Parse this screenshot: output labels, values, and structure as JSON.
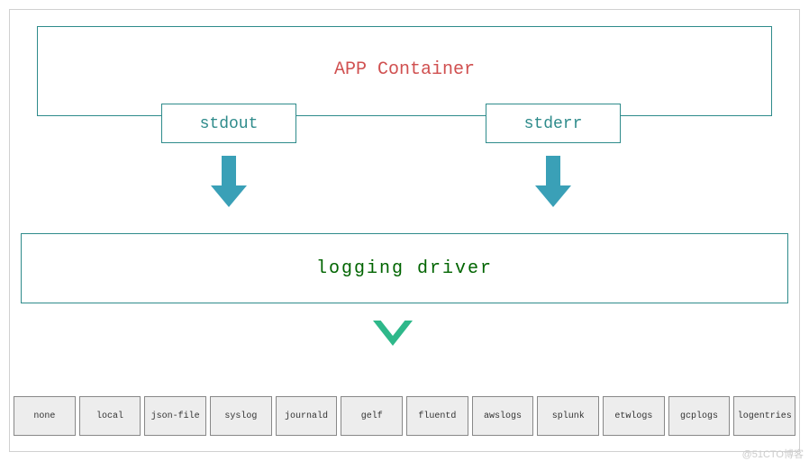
{
  "app_container": {
    "label": "APP Container"
  },
  "streams": {
    "stdout": "stdout",
    "stderr": "stderr"
  },
  "logging_driver": {
    "label": "logging  driver"
  },
  "drivers": [
    {
      "name": "none"
    },
    {
      "name": "local"
    },
    {
      "name": "json-file"
    },
    {
      "name": "syslog"
    },
    {
      "name": "journald"
    },
    {
      "name": "gelf"
    },
    {
      "name": "fluentd"
    },
    {
      "name": "awslogs"
    },
    {
      "name": "splunk"
    },
    {
      "name": "etwlogs"
    },
    {
      "name": "gcplogs"
    },
    {
      "name": "logentries"
    }
  ],
  "watermark": "@51CTO博客"
}
